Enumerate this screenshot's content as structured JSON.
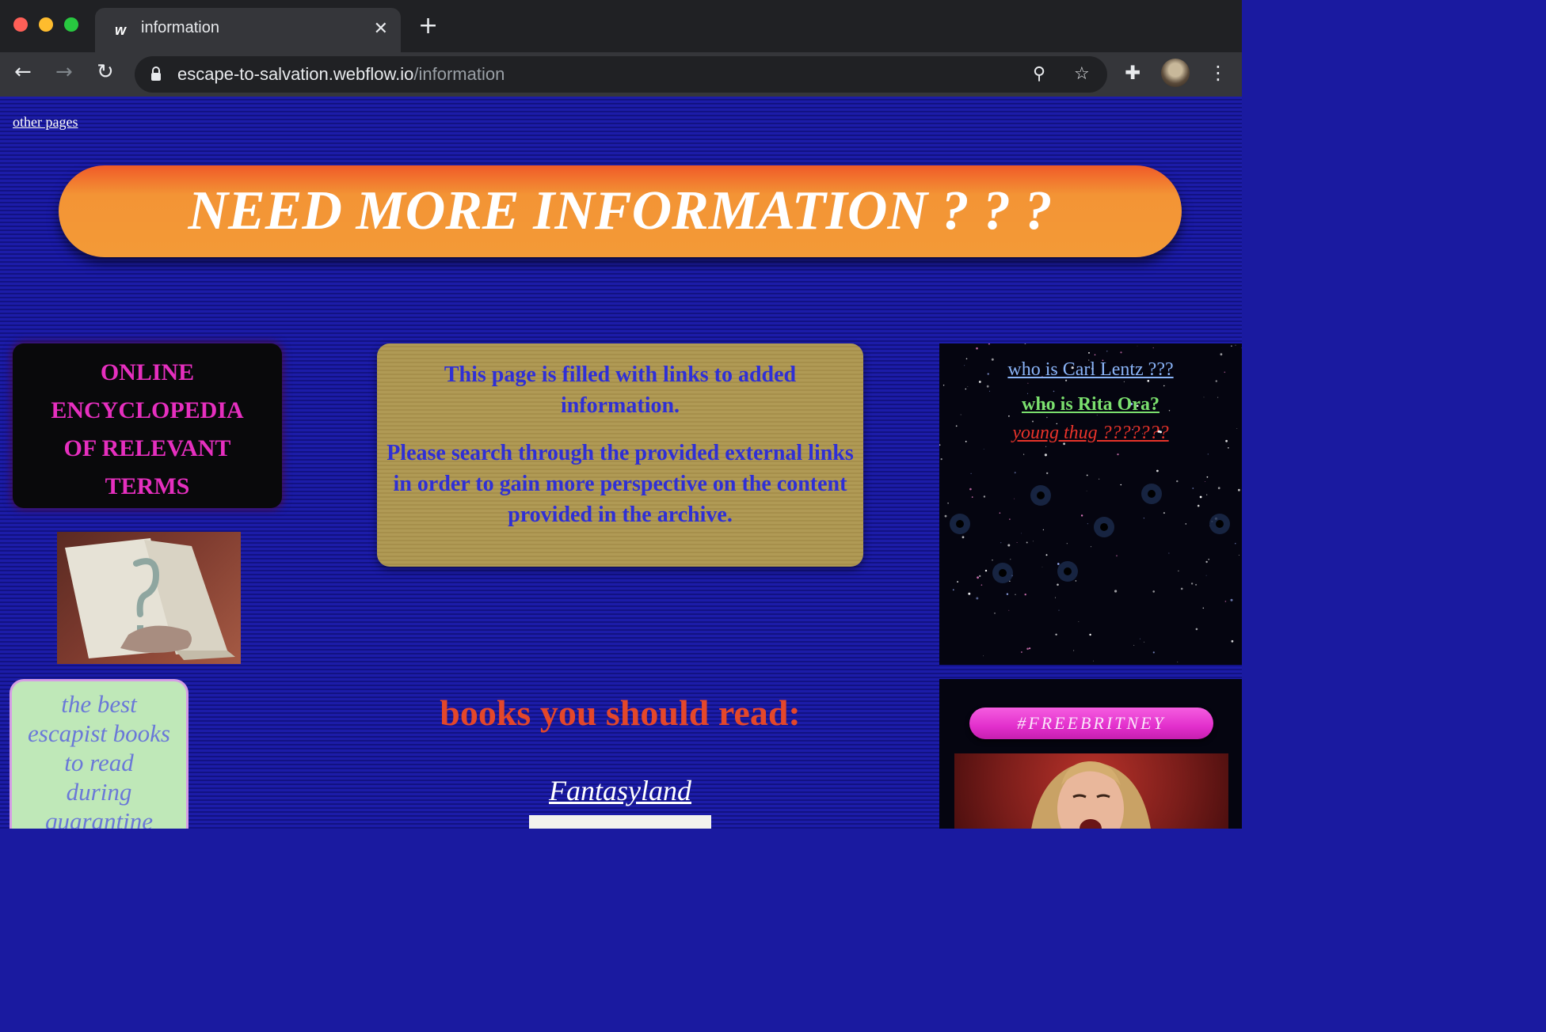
{
  "browser": {
    "tab_title": "information",
    "tab_favicon": "w",
    "url_host": "escape-to-salvation.webflow.io",
    "url_path": "/information",
    "icons": [
      "back-icon",
      "forward-icon",
      "reload-icon",
      "lock-icon",
      "zoom-icon",
      "star-icon",
      "extensions-icon",
      "profile-avatar",
      "menu-icon"
    ]
  },
  "nav": {
    "other_pages": "other pages"
  },
  "banner": {
    "title": "NEED MORE INFORMATION ? ? ?"
  },
  "sidebar": {
    "encyclopedia_lines": [
      "ONLINE",
      "ENCYCLOPEDIA",
      "OF RELEVANT",
      "TERMS"
    ],
    "books_box_lines": [
      "the best",
      "escapist books",
      "to read",
      "during",
      "quarantine"
    ]
  },
  "info": {
    "paragraph_1": "This page is filled with links to added information.",
    "paragraph_2": "Please search through the provided external links in order to gain more perspective on the content provided in the archive."
  },
  "links": [
    {
      "label": "who is Carl Lentz ???",
      "color": "#8ab4f8"
    },
    {
      "label": "who is Rita Ora?",
      "color": "#7be06e"
    },
    {
      "label": "young thug ???????",
      "color": "#e8332a"
    }
  ],
  "books": {
    "heading": "books you should read:",
    "first_title": "Fantasyland"
  },
  "britney": {
    "hashtag": "#FREEBRITNEY"
  },
  "colors": {
    "page_background": "#1a1aa0",
    "banner_orange": "#f39435",
    "encyclopedia_text": "#e62fbf",
    "info_box": "#b09a55",
    "info_text": "#2f2fd6",
    "books_heading": "#e4472a",
    "hashtag_pink": "#e22fcc"
  }
}
